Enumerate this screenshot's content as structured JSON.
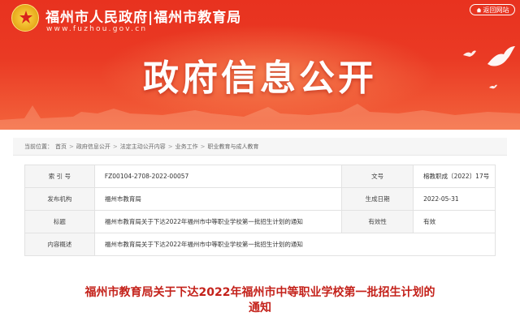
{
  "header": {
    "site_title": "福州市人民政府|福州市教育局",
    "site_url": "www.fuzhou.gov.cn",
    "home_label": "返回网站",
    "banner_title": "政府信息公开"
  },
  "breadcrumb": {
    "prefix": "当前位置：",
    "items": [
      "首页",
      "政府信息公开",
      "法定主动公开内容",
      "业务工作",
      "职业教育与成人教育"
    ],
    "separator": ">"
  },
  "info": {
    "index_label": "索 引 号",
    "index_value": "FZ00104-2708-2022-00057",
    "doc_no_label": "文号",
    "doc_no_value": "榕教职成〔2022〕17号",
    "org_label": "发布机构",
    "org_value": "福州市教育局",
    "date_label": "生成日期",
    "date_value": "2022-05-31",
    "title_label": "标题",
    "title_value": "福州市教育局关于下达2022年福州市中等职业学校第一批招生计划的通知",
    "validity_label": "有效性",
    "validity_value": "有效",
    "summary_label": "内容概述",
    "summary_value": "福州市教育局关于下达2022年福州市中等职业学校第一批招生计划的通知"
  },
  "article": {
    "title": "福州市教育局关于下达2022年福州市中等职业学校第一批招生计划的通知"
  },
  "colors": {
    "banner_red": "#e8321f",
    "title_red": "#c4221b"
  }
}
